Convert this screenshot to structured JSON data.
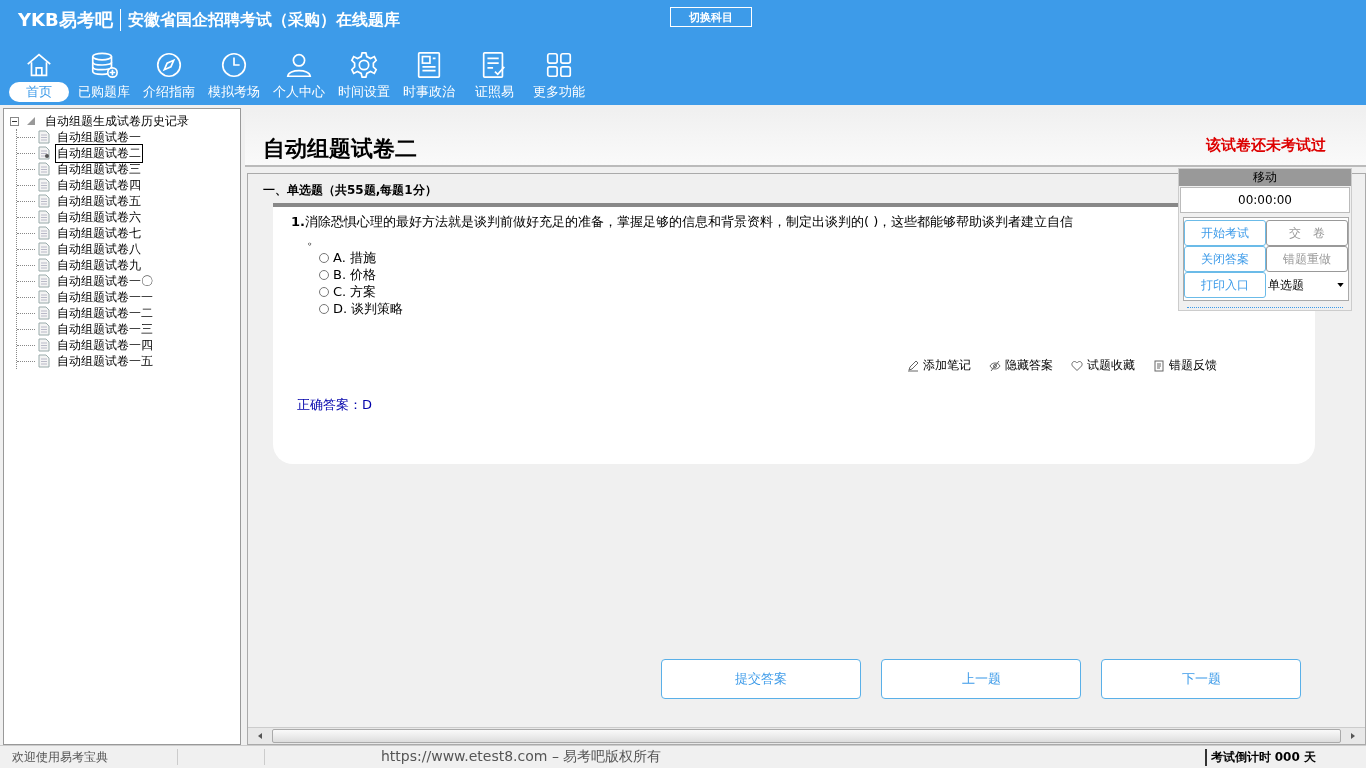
{
  "header": {
    "logo": "YKB易考吧",
    "title": "安徽省国企招聘考试（采购）在线题库",
    "switch_button": "切换科目",
    "nav": [
      {
        "label": "首页",
        "kind": "home",
        "selected": true
      },
      {
        "label": "已购题库",
        "kind": "database",
        "selected": false
      },
      {
        "label": "介绍指南",
        "kind": "compass",
        "selected": false
      },
      {
        "label": "模拟考场",
        "kind": "clock",
        "selected": false
      },
      {
        "label": "个人中心",
        "kind": "person",
        "selected": false
      },
      {
        "label": "时间设置",
        "kind": "gear",
        "selected": false
      },
      {
        "label": "时事政治",
        "kind": "newspaper",
        "selected": false
      },
      {
        "label": "证照易",
        "kind": "checklist",
        "selected": false
      },
      {
        "label": "更多功能",
        "kind": "grid",
        "selected": false
      }
    ]
  },
  "tree": {
    "label": "自动组题生成试卷历史记录",
    "expanded": true,
    "children": [
      {
        "label": "自动组题试卷一",
        "selected": false
      },
      {
        "label": "自动组题试卷二",
        "selected": true
      },
      {
        "label": "自动组题试卷三",
        "selected": false
      },
      {
        "label": "自动组题试卷四",
        "selected": false
      },
      {
        "label": "自动组题试卷五",
        "selected": false
      },
      {
        "label": "自动组题试卷六",
        "selected": false
      },
      {
        "label": "自动组题试卷七",
        "selected": false
      },
      {
        "label": "自动组题试卷八",
        "selected": false
      },
      {
        "label": "自动组题试卷九",
        "selected": false
      },
      {
        "label": "自动组题试卷一〇",
        "selected": false
      },
      {
        "label": "自动组题试卷一一",
        "selected": false
      },
      {
        "label": "自动组题试卷一二",
        "selected": false
      },
      {
        "label": "自动组题试卷一三",
        "selected": false
      },
      {
        "label": "自动组题试卷一四",
        "selected": false
      },
      {
        "label": "自动组题试卷一五",
        "selected": false
      }
    ]
  },
  "paper": {
    "title": "自动组题试卷二",
    "status": "该试卷还未考试过",
    "section": "一、单选题（共55题,每题1分）",
    "question": {
      "number": "1.",
      "text": "消除恐惧心理的最好方法就是谈判前做好充足的准备，掌握足够的信息和背景资料，制定出谈判的( )，这些都能够帮助谈判者建立自信",
      "continuation": "。",
      "options": [
        {
          "label": "A.",
          "text": "措施",
          "selected": false
        },
        {
          "label": "B.",
          "text": "价格",
          "selected": false
        },
        {
          "label": "C.",
          "text": "方案",
          "selected": false
        },
        {
          "label": "D.",
          "text": "谈判策略",
          "selected": false
        }
      ],
      "actions": [
        {
          "label": "添加笔记",
          "kind": "pencil"
        },
        {
          "label": "隐藏答案",
          "kind": "eye"
        },
        {
          "label": "试题收藏",
          "kind": "heart"
        },
        {
          "label": "错题反馈",
          "kind": "note"
        }
      ],
      "answer_label": "正确答案：",
      "answer": "D"
    },
    "bottom_buttons": [
      "提交答案",
      "上一题",
      "下一题"
    ]
  },
  "timer_panel": {
    "title": "移动",
    "time": "00:00:00",
    "buttons": [
      {
        "label": "开始考试",
        "disabled": false
      },
      {
        "label": "交　卷",
        "disabled": true
      },
      {
        "label": "关闭答案",
        "disabled": false
      },
      {
        "label": "错题重做",
        "disabled": true
      },
      {
        "label": "打印入口",
        "disabled": false
      }
    ],
    "select_value": "单选题"
  },
  "status_bar": {
    "welcome": "欢迎使用易考宝典",
    "copyright": "https://www.etest8.com – 易考吧版权所有",
    "countdown": "考试倒计时 000 天"
  }
}
